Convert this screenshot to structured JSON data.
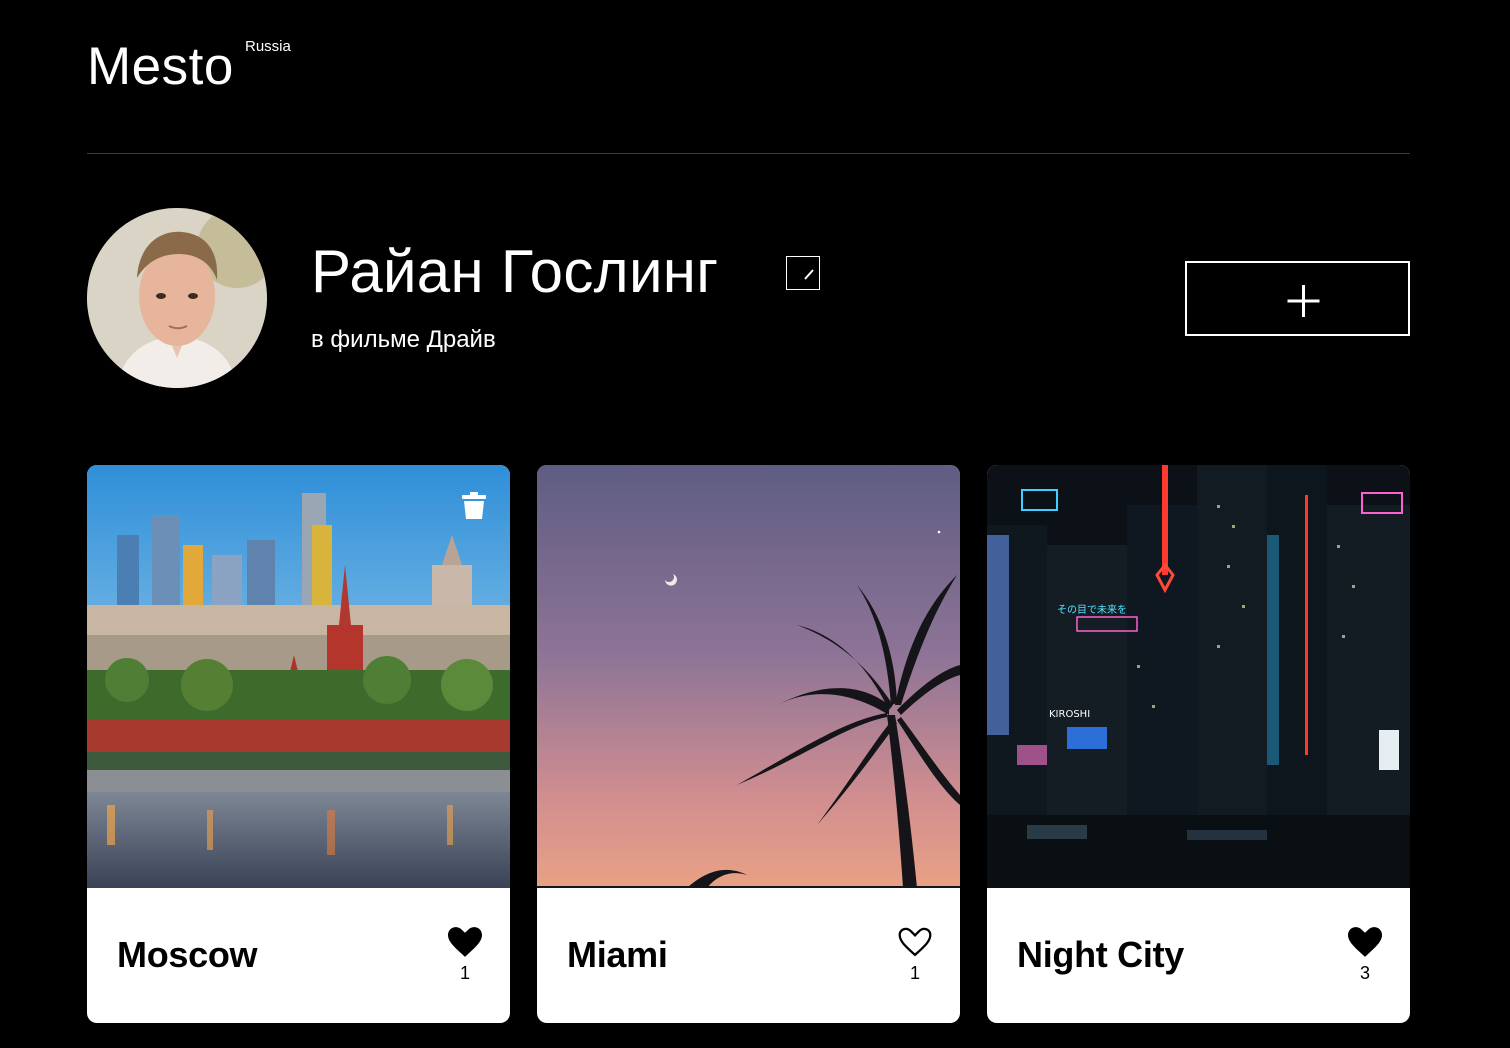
{
  "header": {
    "logo": "Mesto",
    "logo_sup": "Russia"
  },
  "profile": {
    "name": "Райан Гослинг",
    "about": "в фильме Драйв"
  },
  "icons": {
    "edit": "pencil-icon",
    "add": "plus-icon",
    "like": "heart-icon",
    "delete": "trash-icon"
  },
  "cards": [
    {
      "title": "Moscow",
      "likes": "1",
      "liked": true,
      "deletable": true
    },
    {
      "title": "Miami",
      "likes": "1",
      "liked": false,
      "deletable": false
    },
    {
      "title": "Night City",
      "likes": "3",
      "liked": true,
      "deletable": false
    }
  ]
}
